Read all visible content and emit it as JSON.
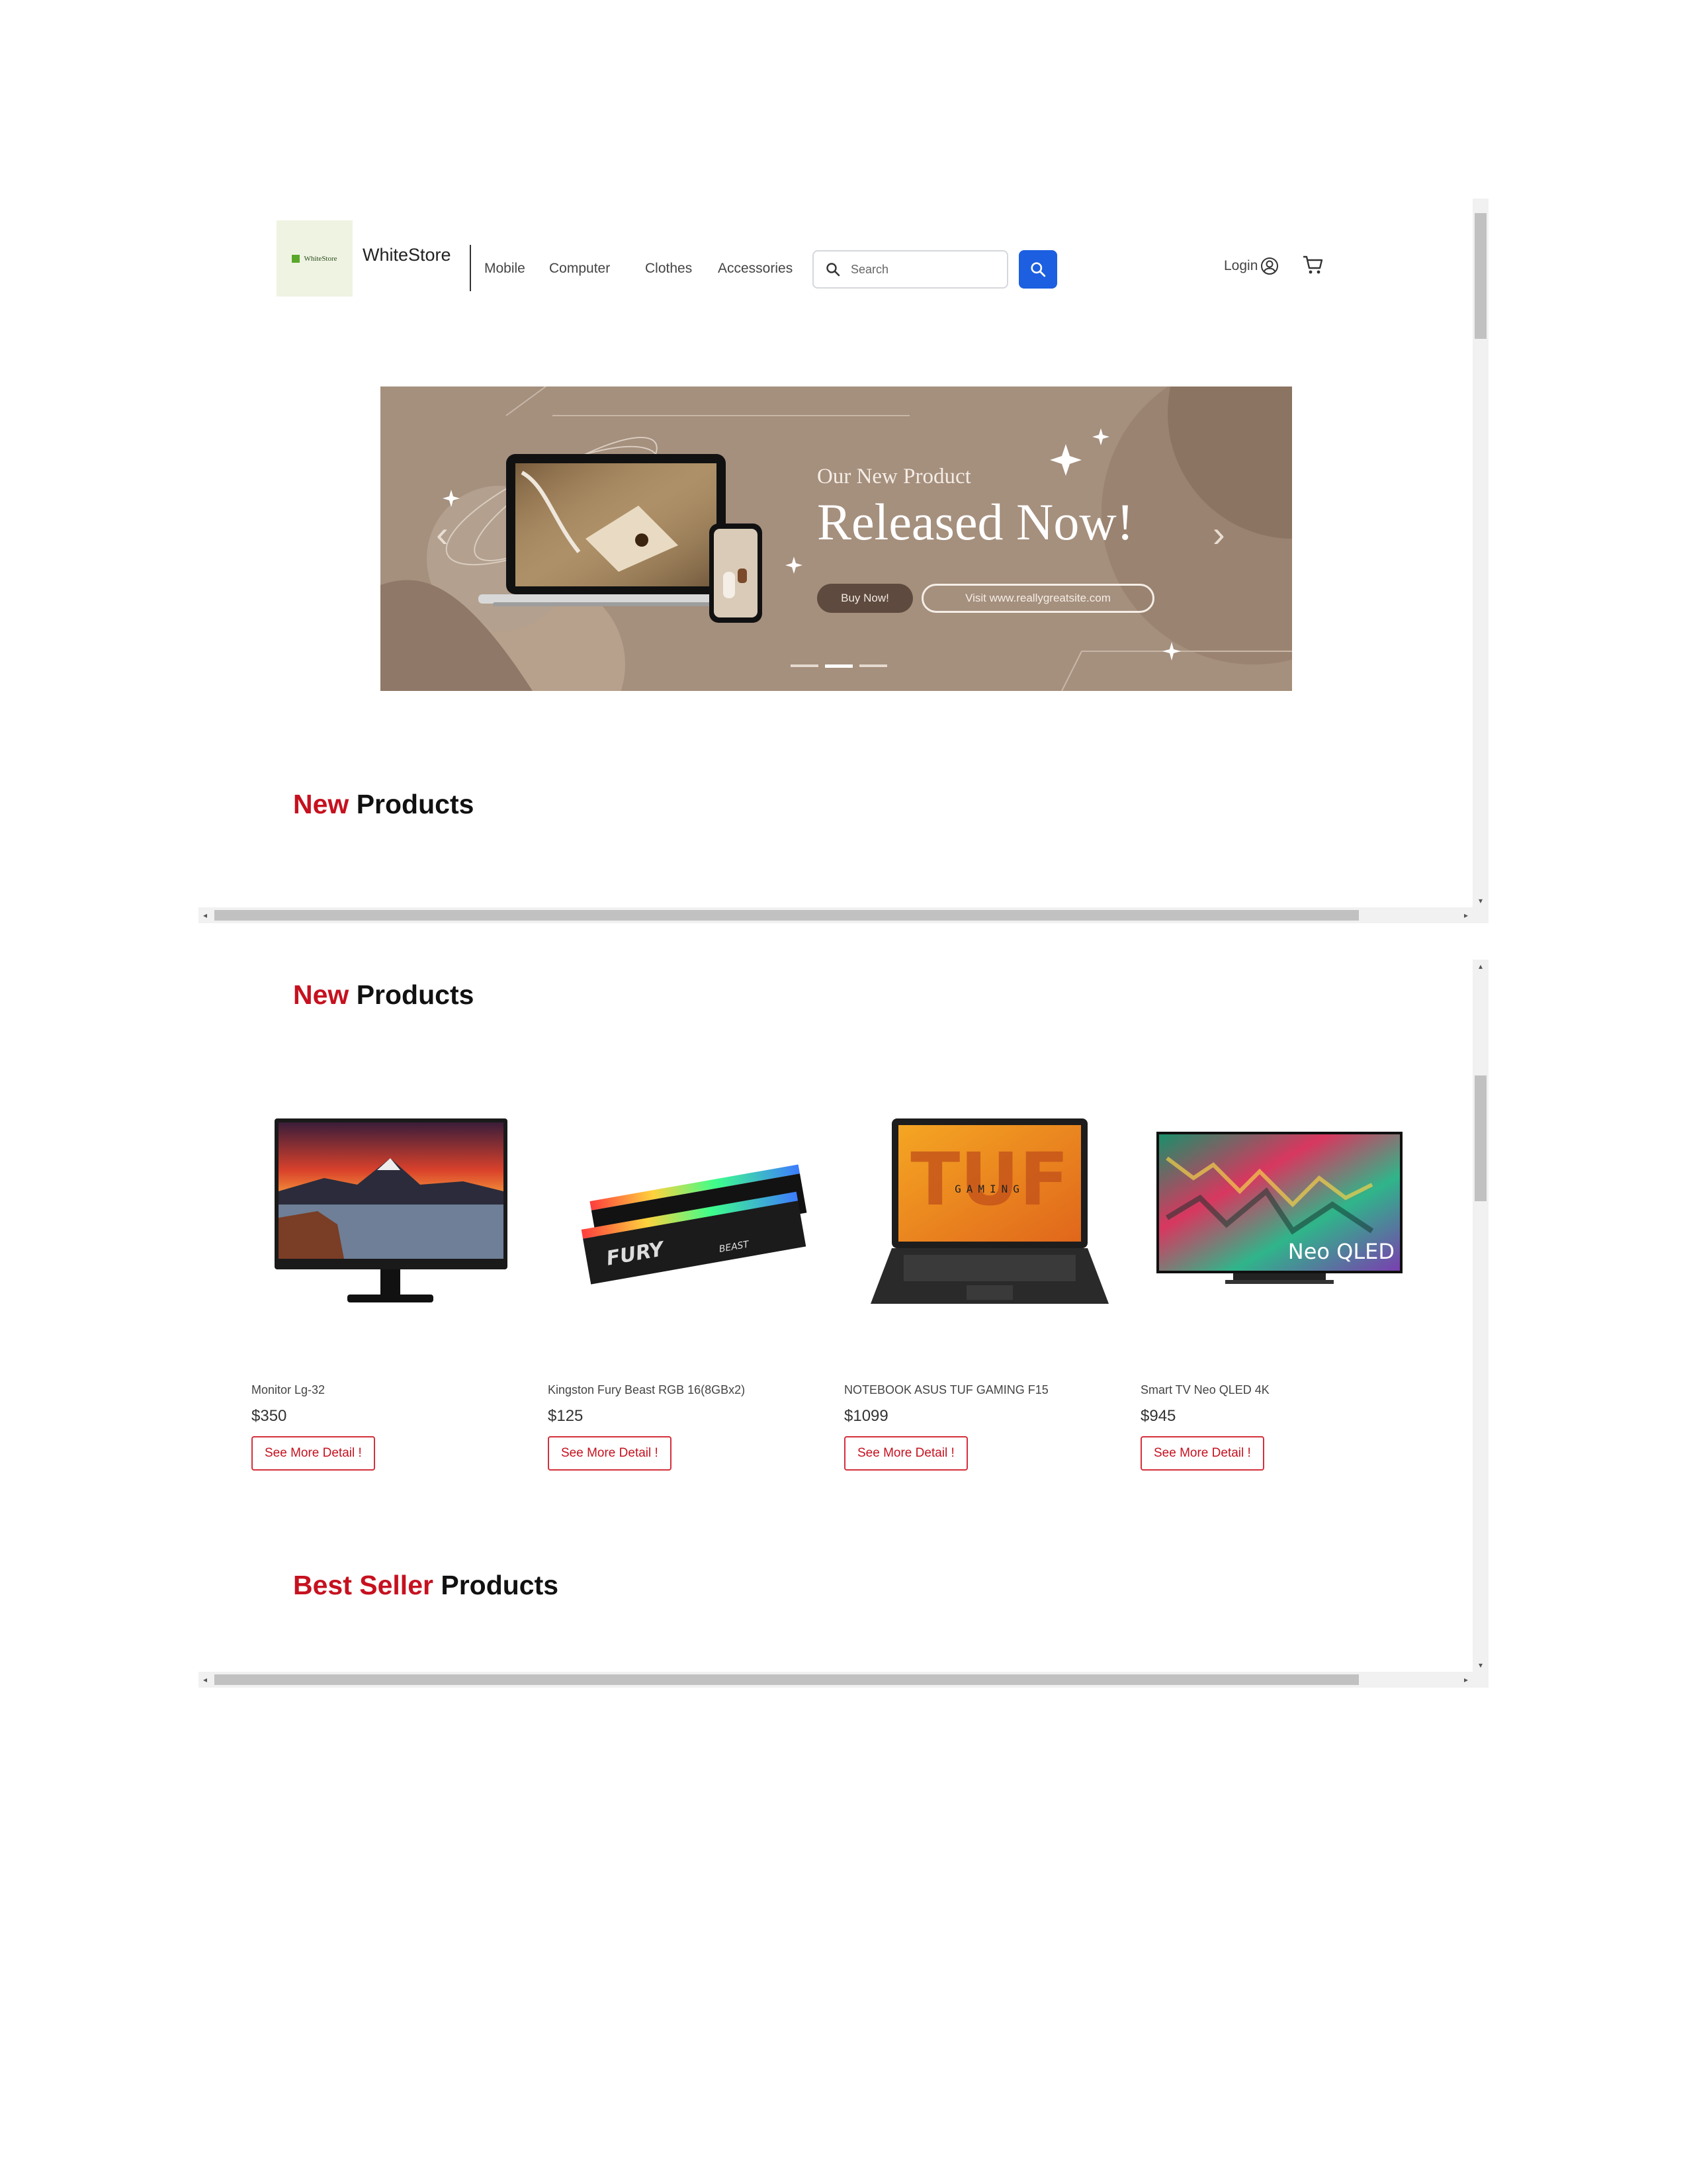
{
  "navbar": {
    "logo_text": "WhiteStore",
    "brand": "WhiteStore",
    "links": [
      "Mobile",
      "Computer",
      "Clothes",
      "Accessories"
    ],
    "search_placeholder": "Search",
    "login_label": "Login"
  },
  "banner": {
    "subtitle": "Our New Product",
    "title": "Released Now!",
    "buy_button": "Buy Now!",
    "visit_button": "Visit www.reallygreatsite.com"
  },
  "sections": {
    "new_products": {
      "accent": "New",
      "rest": " Products"
    },
    "best_seller": {
      "accent": "Best Seller",
      "rest": " Products"
    }
  },
  "products": [
    {
      "name": "Monitor Lg-32",
      "price": "$350",
      "button": "See More Detail !"
    },
    {
      "name": "Kingston Fury Beast RGB 16(8GBx2)",
      "price": "$125",
      "button": "See More Detail !"
    },
    {
      "name": "NOTEBOOK ASUS TUF GAMING F15",
      "price": "$1099",
      "button": "See More Detail !"
    },
    {
      "name": "Smart TV Neo QLED 4K",
      "price": "$945",
      "button": "See More Detail !"
    }
  ],
  "product_image_text": {
    "ram_brand": "FURY",
    "ram_model": "BEAST",
    "laptop_logo": "TUF",
    "laptop_sub": "GAMING",
    "tv_label": "Neo QLED"
  },
  "colors": {
    "accent_red": "#c6111f",
    "primary_blue": "#1c5fe0",
    "banner_bg": "#a58f7d"
  }
}
